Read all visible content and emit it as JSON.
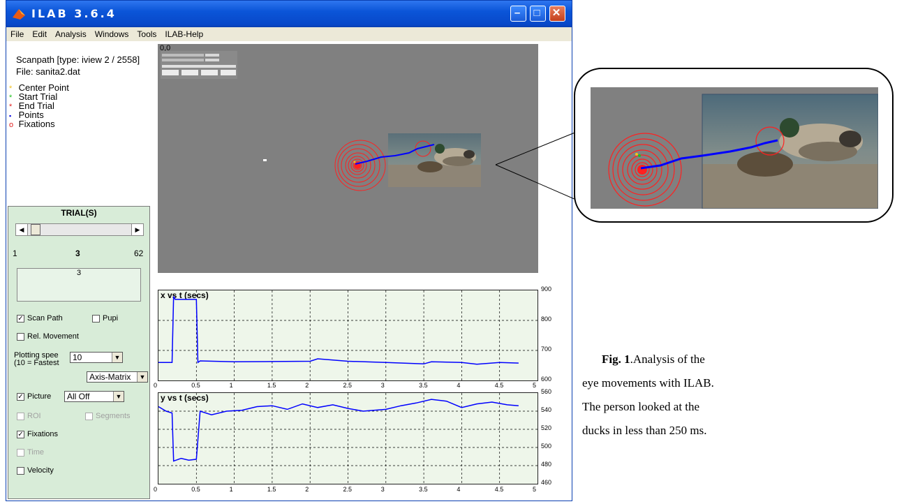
{
  "window": {
    "title": "ILAB 3.6.4",
    "menu": [
      "File",
      "Edit",
      "Analysis",
      "Windows",
      "Tools",
      "ILAB-Help"
    ]
  },
  "legend": {
    "scanpath": "Scanpath  [type: iview 2 / 2558]",
    "file": "File: sanita2.dat",
    "items": [
      {
        "label": "Center Point",
        "marker": "*",
        "color": "#f0c020"
      },
      {
        "label": "Start Trial",
        "marker": "*",
        "color": "#20c020"
      },
      {
        "label": "End Trial",
        "marker": "*",
        "color": "#e02020"
      },
      {
        "label": "Points",
        "marker": "▪",
        "color": "#0000e0"
      },
      {
        "label": "Fixations",
        "marker": "o",
        "color": "#e02020"
      }
    ]
  },
  "trial_panel": {
    "title": "TRIAL(S)",
    "slider_min": "1",
    "slider_current": "3",
    "slider_max": "62",
    "slider_position": 0.033,
    "listbox_value": "3",
    "scan_path_label": "Scan Path",
    "pupil_label": "Pupi",
    "rel_movement_label": "Rel. Movement",
    "plotting_speed_label": "Plotting spee",
    "plotting_speed_sub": "(10 = Fastest",
    "plotting_speed_value": "10",
    "axis_value": "Axis-Matrix",
    "picture_label": "Picture",
    "picture_value": "All Off",
    "roi_label": "ROI",
    "segments_label": "Segments",
    "fixations_label": "Fixations",
    "time_label": "Time",
    "velocity_label": "Velocity",
    "checks": {
      "scan_path": true,
      "pupil": false,
      "rel_movement": false,
      "picture": true,
      "roi": false,
      "segments": false,
      "fixations": true,
      "time": false,
      "velocity": false
    }
  },
  "scene": {
    "origin_label": "0,0"
  },
  "chart_data": [
    {
      "type": "line",
      "title": "x vs t (secs)",
      "x_ticks": [
        "0",
        "0.5",
        "1",
        "1.5",
        "2",
        "2.5",
        "3",
        "3.5",
        "4",
        "4.5",
        "5"
      ],
      "y_ticks": [
        "600",
        "700",
        "800",
        "900"
      ],
      "xlim": [
        0,
        5
      ],
      "ylim": [
        600,
        900
      ],
      "grid": true,
      "series": [
        {
          "x": [
            0,
            0.18,
            0.2,
            0.22,
            0.5,
            0.52,
            0.55,
            1,
            1.5,
            2,
            2.1,
            2.5,
            3,
            3.5,
            3.6,
            4,
            4.2,
            4.5,
            4.75
          ],
          "y": [
            660,
            660,
            880,
            870,
            870,
            660,
            665,
            662,
            663,
            664,
            672,
            664,
            660,
            655,
            662,
            660,
            654,
            660,
            658
          ],
          "color": "#0000ff"
        }
      ]
    },
    {
      "type": "line",
      "title": "y vs t (secs)",
      "x_ticks": [
        "0",
        "0.5",
        "1",
        "1.5",
        "2",
        "2.5",
        "3",
        "3.5",
        "4",
        "4.5",
        "5"
      ],
      "y_ticks": [
        "460",
        "480",
        "500",
        "520",
        "540",
        "560"
      ],
      "xlim": [
        0,
        5
      ],
      "ylim": [
        460,
        560
      ],
      "grid": true,
      "series": [
        {
          "x": [
            0,
            0.1,
            0.18,
            0.2,
            0.3,
            0.4,
            0.5,
            0.55,
            0.7,
            0.9,
            1.1,
            1.3,
            1.5,
            1.7,
            1.9,
            2.1,
            2.3,
            2.5,
            2.7,
            3,
            3.2,
            3.4,
            3.6,
            3.8,
            4,
            4.2,
            4.4,
            4.6,
            4.75
          ],
          "y": [
            545,
            540,
            538,
            485,
            488,
            486,
            487,
            540,
            536,
            540,
            541,
            545,
            546,
            542,
            548,
            544,
            547,
            543,
            540,
            542,
            546,
            549,
            553,
            551,
            544,
            548,
            550,
            547,
            546
          ],
          "color": "#0000ff"
        }
      ]
    }
  ],
  "caption": {
    "fig_label": "Fig. 1",
    "text": ".Analysis of the eye movements with ILAB. The person looked at the ducks in less than 250 ms."
  }
}
